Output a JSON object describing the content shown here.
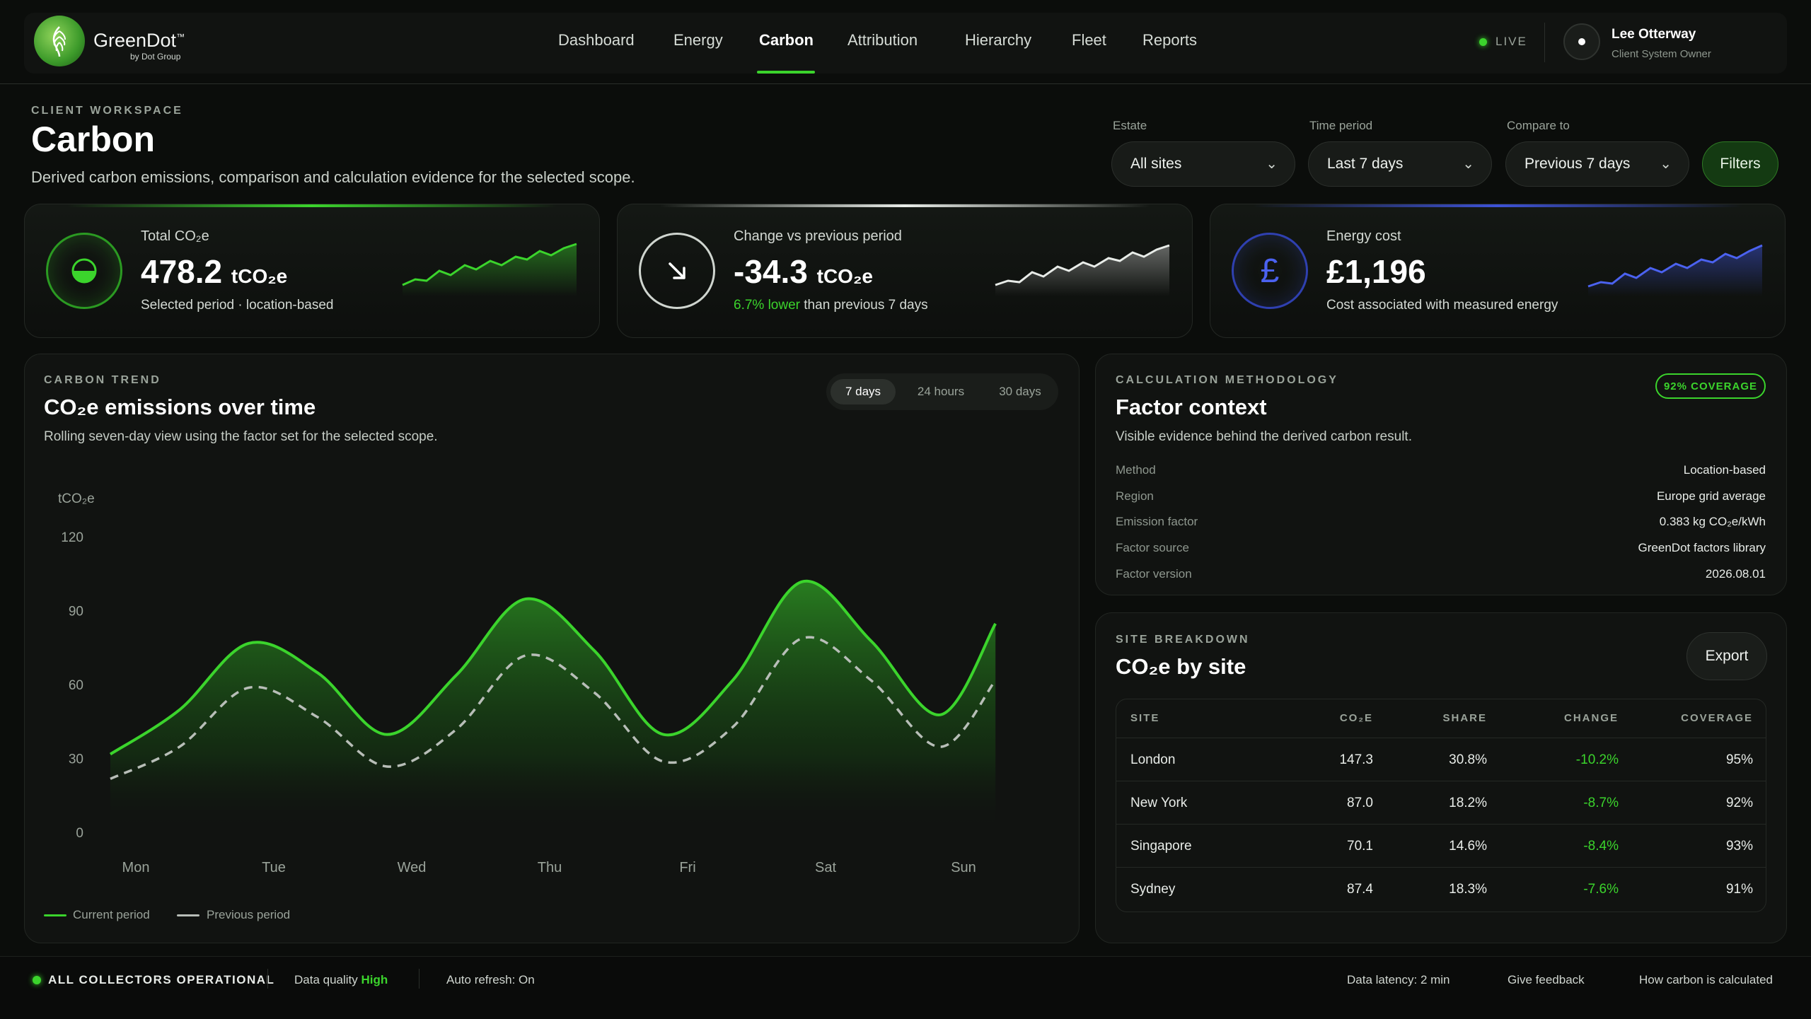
{
  "brand": {
    "name": "GreenDot",
    "name_suffix": "™",
    "sub": "by Dot Group"
  },
  "nav": {
    "items": [
      "Dashboard",
      "Energy",
      "Carbon",
      "Attribution",
      "Hierarchy",
      "Fleet",
      "Reports"
    ],
    "active": "Carbon",
    "live_label": "LIVE"
  },
  "user": {
    "name": "Lee Otterway",
    "role": "Client System Owner"
  },
  "header": {
    "eyebrow": "CLIENT WORKSPACE",
    "title": "Carbon",
    "description": "Derived carbon emissions, comparison and calculation evidence for the selected scope."
  },
  "filters": {
    "estate": {
      "label": "Estate",
      "value": "All sites"
    },
    "time_period": {
      "label": "Time period",
      "value": "Last 7 days"
    },
    "compare_to": {
      "label": "Compare to",
      "value": "Previous 7 days"
    },
    "button": "Filters"
  },
  "kpis": {
    "total": {
      "label": "Total CO₂e",
      "value": "478.2",
      "unit": "tCO₂e",
      "sub": "Selected period · location-based",
      "color": "#3bd42c"
    },
    "change": {
      "label": "Change vs previous period",
      "value": "-34.3",
      "unit": "tCO₂e",
      "sub_highlight": "6.7% lower",
      "sub_rest": " than previous 7 days",
      "color": "#e8ece8"
    },
    "cost": {
      "label": "Energy cost",
      "value": "£1,196",
      "sub": "Cost associated with measured energy",
      "color": "#3d52d6",
      "icon_glyph": "£"
    }
  },
  "trend": {
    "eyebrow": "CARBON TREND",
    "title": "CO₂e emissions over time",
    "description": "Rolling seven-day view using the factor set for the selected scope.",
    "ranges": [
      "7 days",
      "24 hours",
      "30 days"
    ],
    "active_range": "7 days",
    "legend_current": "Current period",
    "legend_previous": "Previous period"
  },
  "chart_data": {
    "type": "area",
    "ylabel": "tCO₂e",
    "categories": [
      "Mon",
      "Tue",
      "Wed",
      "Thu",
      "Fri",
      "Sat",
      "Sun"
    ],
    "ylim": [
      0,
      120
    ],
    "yticks": [
      0,
      30,
      60,
      90,
      120
    ],
    "x": [
      0,
      0.5,
      1,
      1.5,
      2,
      2.5,
      3,
      3.5,
      4,
      4.5,
      5,
      5.5,
      6,
      6.4
    ],
    "series": [
      {
        "name": "Current period",
        "values": [
          32,
          50,
          77,
          65,
          40,
          64,
          95,
          74,
          40,
          62,
          102,
          78,
          48,
          85
        ],
        "color": "#3bd42c"
      },
      {
        "name": "Previous period",
        "values": [
          22,
          35,
          59,
          47,
          27,
          42,
          72,
          57,
          29,
          43,
          79,
          62,
          35,
          62
        ],
        "color": "#b8beb8"
      }
    ],
    "grid": false,
    "legend": "bottom-left"
  },
  "methodology": {
    "eyebrow": "CALCULATION METHODOLOGY",
    "title": "Factor context",
    "description": "Visible evidence behind the derived carbon result.",
    "badge": "92% COVERAGE",
    "rows": [
      {
        "k": "Method",
        "v": "Location-based"
      },
      {
        "k": "Region",
        "v": "Europe grid average"
      },
      {
        "k": "Emission factor",
        "v": "0.383 kg CO₂e/kWh"
      },
      {
        "k": "Factor source",
        "v": "GreenDot factors library"
      },
      {
        "k": "Factor version",
        "v": "2026.08.01"
      }
    ]
  },
  "sites": {
    "eyebrow": "SITE BREAKDOWN",
    "title": "CO₂e by site",
    "export": "Export",
    "columns": [
      "SITE",
      "CO₂E",
      "SHARE",
      "CHANGE",
      "COVERAGE"
    ],
    "rows": [
      [
        "London",
        "147.3",
        "30.8%",
        "-10.2%",
        "95%"
      ],
      [
        "New York",
        "87.0",
        "18.2%",
        "-8.7%",
        "92%"
      ],
      [
        "Singapore",
        "70.1",
        "14.6%",
        "-8.4%",
        "93%"
      ],
      [
        "Sydney",
        "87.4",
        "18.3%",
        "-7.6%",
        "91%"
      ]
    ]
  },
  "footer": {
    "status": "ALL COLLECTORS OPERATIONAL",
    "quality_label": "Data quality",
    "quality_value": "High",
    "refresh": "Auto refresh: On",
    "latency": "Data latency: 2 min",
    "feedback": "Give feedback",
    "how": "How carbon is calculated"
  }
}
